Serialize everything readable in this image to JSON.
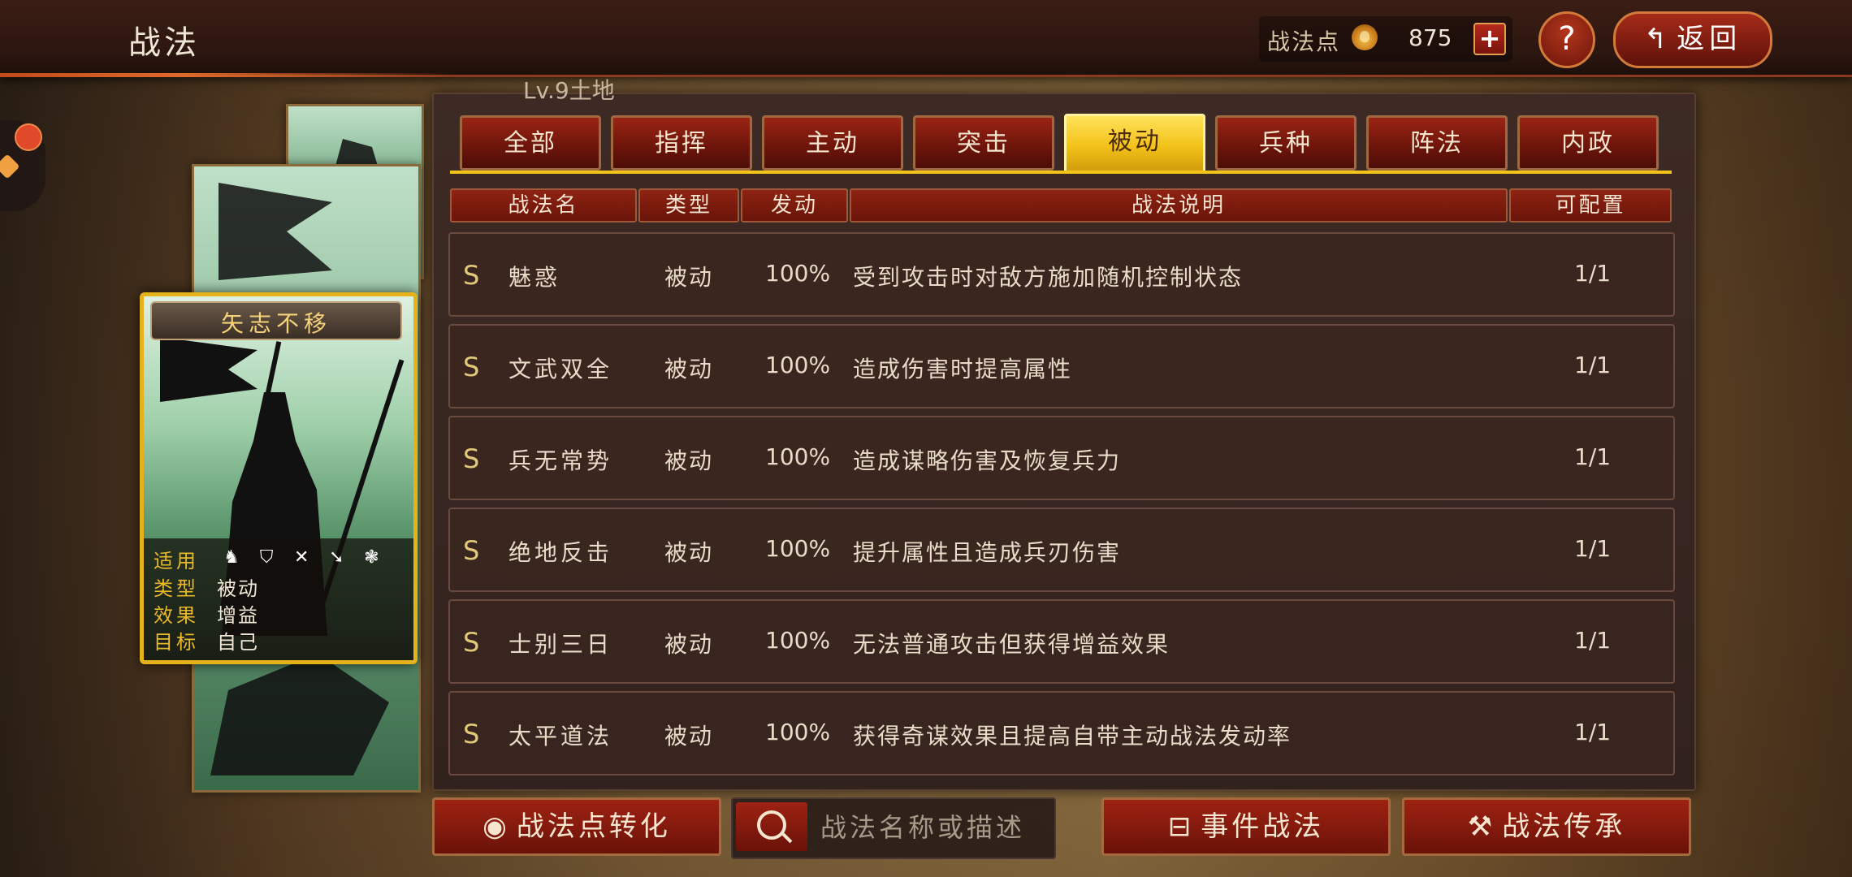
{
  "header": {
    "title": "战法",
    "points_label": "战法点",
    "points_value": "875",
    "plus_label": "+",
    "help_label": "?",
    "back_label": "返回"
  },
  "card": {
    "name": "矢志不移",
    "info": [
      {
        "key": "适用",
        "value": ""
      },
      {
        "key": "类型",
        "value": "被动"
      },
      {
        "key": "效果",
        "value": "增益"
      },
      {
        "key": "目标",
        "value": "自己"
      }
    ],
    "unit_icons": [
      "cavalry-icon",
      "shield-icon",
      "bow-icon",
      "spear-icon",
      "wheel-icon"
    ]
  },
  "panel": {
    "level_text": "Lv.9土地",
    "tabs": [
      {
        "label": "全部"
      },
      {
        "label": "指挥"
      },
      {
        "label": "主动"
      },
      {
        "label": "突击"
      },
      {
        "label": "被动"
      },
      {
        "label": "兵种"
      },
      {
        "label": "阵法"
      },
      {
        "label": "内政"
      }
    ],
    "active_tab": "被动",
    "columns": {
      "name": "战法名",
      "type": "类型",
      "trigger": "发动",
      "desc": "战法说明",
      "config": "可配置"
    },
    "rows": [
      {
        "grade": "S",
        "name": "魅惑",
        "type": "被动",
        "rate": "100%",
        "desc": "受到攻击时对敌方施加随机控制状态",
        "config": "1/1"
      },
      {
        "grade": "S",
        "name": "文武双全",
        "type": "被动",
        "rate": "100%",
        "desc": "造成伤害时提高属性",
        "config": "1/1"
      },
      {
        "grade": "S",
        "name": "兵无常势",
        "type": "被动",
        "rate": "100%",
        "desc": "造成谋略伤害及恢复兵力",
        "config": "1/1"
      },
      {
        "grade": "S",
        "name": "绝地反击",
        "type": "被动",
        "rate": "100%",
        "desc": "提升属性且造成兵刃伤害",
        "config": "1/1"
      },
      {
        "grade": "S",
        "name": "士别三日",
        "type": "被动",
        "rate": "100%",
        "desc": "无法普通攻击但获得增益效果",
        "config": "1/1"
      },
      {
        "grade": "S",
        "name": "太平道法",
        "type": "被动",
        "rate": "100%",
        "desc": "获得奇谋效果且提高自带主动战法发动率",
        "config": "1/1"
      }
    ]
  },
  "bottom": {
    "convert_label": "战法点转化",
    "search_placeholder": "战法名称或描述",
    "event_label": "事件战法",
    "inherit_label": "战法传承"
  },
  "colors": {
    "accent_gold": "#f2c318",
    "button_red": "#9e2212",
    "grade_gold": "#e2c97a"
  }
}
